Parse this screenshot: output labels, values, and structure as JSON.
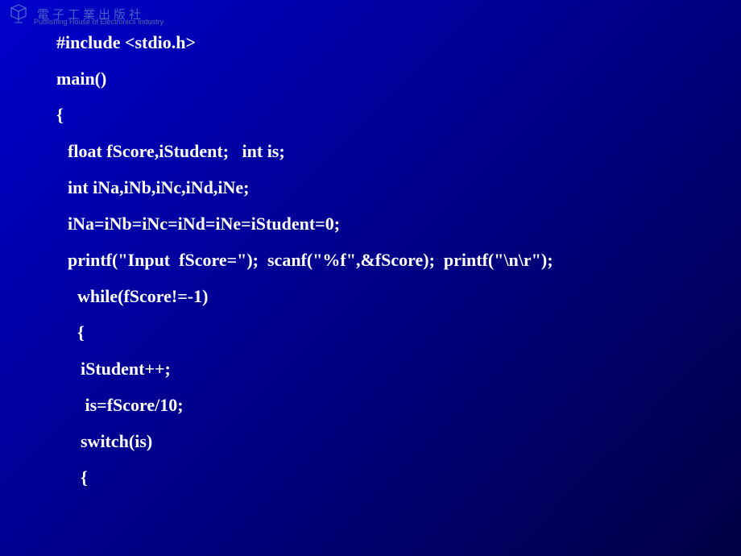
{
  "watermark": {
    "text": "電子工業出版社",
    "subtext": "Publishing House of Electronics Industry"
  },
  "code": {
    "lines": [
      {
        "text": "#include <stdio.h>",
        "indent": 0
      },
      {
        "text": "main()",
        "indent": 0
      },
      {
        "text": "{",
        "indent": 0
      },
      {
        "text": "float fScore,iStudent;   int is;",
        "indent": 1
      },
      {
        "text": "int iNa,iNb,iNc,iNd,iNe;",
        "indent": 1
      },
      {
        "text": "iNa=iNb=iNc=iNd=iNe=iStudent=0;",
        "indent": 1
      },
      {
        "text": "printf(\"Input  fScore=\");  scanf(\"%f\",&fScore);  printf(\"\\n\\r\");",
        "indent": 1
      },
      {
        "text": "while(fScore!=-1)",
        "indent": 2
      },
      {
        "text": "{",
        "indent": 2
      },
      {
        "text": "iStudent++;",
        "indent": 3
      },
      {
        "text": " is=fScore/10;",
        "indent": 3
      },
      {
        "text": "switch(is)",
        "indent": 3
      },
      {
        "text": "{",
        "indent": 3
      }
    ]
  }
}
